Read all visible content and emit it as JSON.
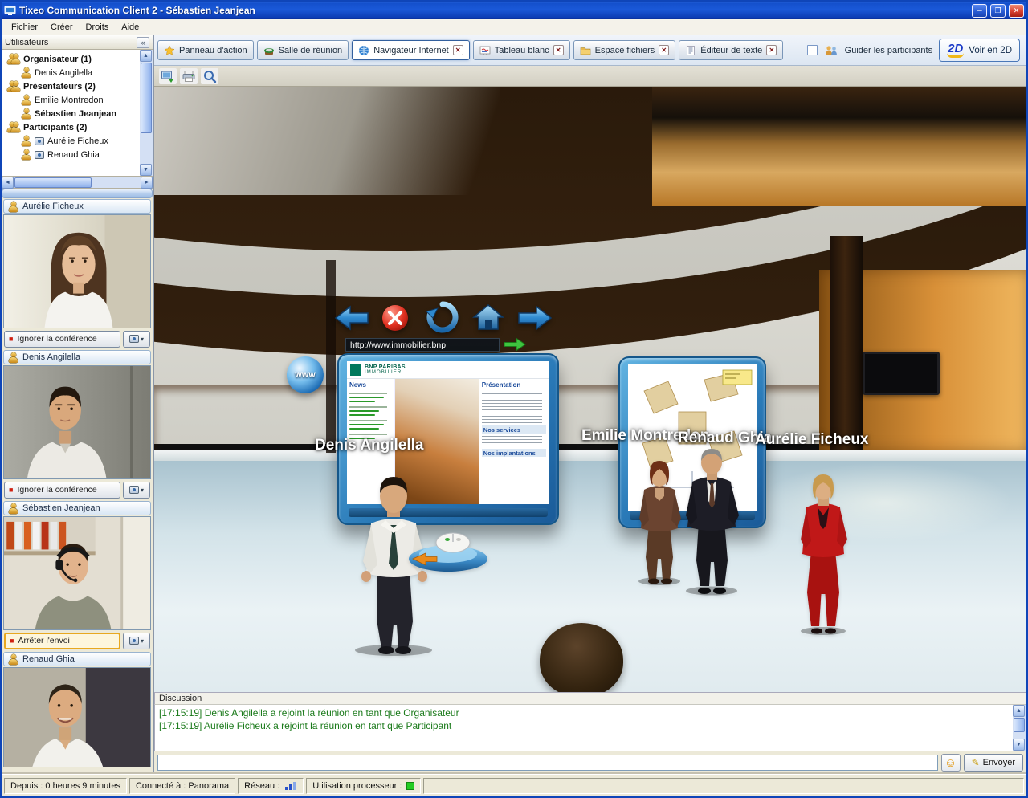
{
  "window": {
    "title": "Tixeo Communication Client 2 - Sébastien Jeanjean"
  },
  "icons": {
    "minimize": "─",
    "restore": "❐",
    "close": "✕",
    "collapse": "«",
    "dropdown": "▾",
    "scroll_up": "▲",
    "scroll_down": "▼",
    "scroll_left": "◄",
    "scroll_right": "►",
    "stop": "■",
    "pencil": "✎",
    "smiley": "☺",
    "tab_close": "✕"
  },
  "menubar": [
    "Fichier",
    "Créer",
    "Droits",
    "Aide"
  ],
  "sidebar": {
    "title": "Utilisateurs",
    "groups": [
      "Organisateur (1)",
      "Présentateurs (2)",
      "Participants (2)"
    ],
    "members": [
      "Denis Angilella",
      "Emilie Montredon",
      "Sébastien Jeanjean",
      "Aurélie Ficheux",
      "Renaud Ghia"
    ],
    "videos": [
      {
        "name": "Aurélie Ficheux",
        "action": "Ignorer la conférence"
      },
      {
        "name": "Denis Angilella",
        "action": "Ignorer la conférence"
      },
      {
        "name": "Sébastien Jeanjean",
        "action": "Arrêter l'envoi"
      },
      {
        "name": "Renaud Ghia",
        "action": ""
      }
    ]
  },
  "tabs": [
    {
      "label": "Panneau d'action"
    },
    {
      "label": "Salle de réunion"
    },
    {
      "label": "Navigateur Internet"
    },
    {
      "label": "Tableau blanc"
    },
    {
      "label": "Espace fichiers"
    },
    {
      "label": "Éditeur de texte"
    }
  ],
  "topbar": {
    "guide_label": "Guider les participants",
    "view2d_label": "Voir en 2D",
    "view2d_icon": "2D"
  },
  "scene": {
    "url": "http://www.immobilier.bnp",
    "globe_text": "WWW",
    "name_labels": [
      "Denis Angilella",
      "Emilie Montredon",
      "Renaud Ghia",
      "Aurélie Ficheux"
    ],
    "page": {
      "brand_line1": "BNP PARIBAS",
      "brand_line2": "IMMOBILIER",
      "news": "News",
      "presentation": "Présentation",
      "services": "Nos services",
      "implantations": "Nos implantations"
    }
  },
  "chat": {
    "title": "Discussion",
    "messages": [
      "[17:15:19] Denis Angilella a rejoint la réunion en tant que Organisateur",
      "[17:15:19] Aurélie Ficheux a rejoint la réunion en tant que Participant"
    ],
    "input_value": "",
    "send_label": "Envoyer"
  },
  "statusbar": {
    "since": "Depuis : 0 heures 9 minutes",
    "connected": "Connecté à : Panorama",
    "network": "Réseau :",
    "cpu": "Utilisation processeur :"
  }
}
